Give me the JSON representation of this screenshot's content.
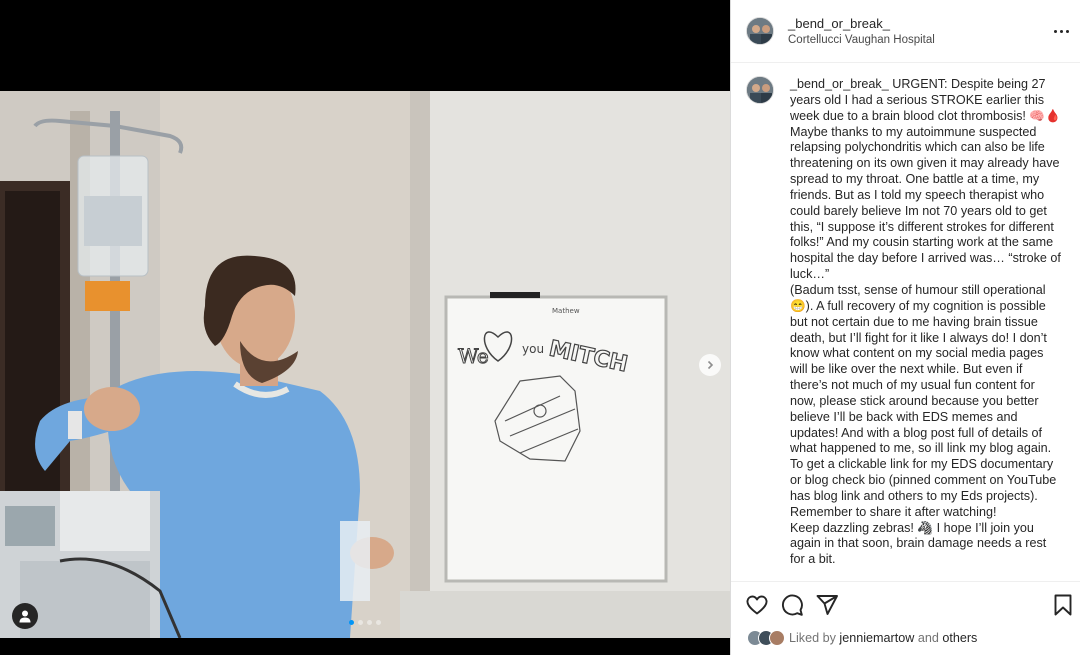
{
  "post": {
    "username": "_bend_or_break_",
    "location": "Cortellucci Vaughan Hospital",
    "avatar_icon": "profile-photo",
    "more_icon": "more-horizontal-icon"
  },
  "caption": {
    "username": "_bend_or_break_",
    "text": "URGENT: Despite being 27 years old I had a serious STROKE earlier this week due to a brain blood clot thrombosis! 🧠🩸\nMaybe thanks to my autoimmune suspected relapsing polychondritis which can also be life threatening on its own given it may already have spread to my throat. One battle at a time, my friends. But as I told my speech therapist who could barely believe Im not 70 years old to get this, “I suppose it’s different strokes for different folks!” And my cousin starting work at the same hospital the day before I arrived was… “stroke of luck…”\n(Badum tsst, sense of humour still operational 😁). A full recovery of my cognition is possible but not certain due to me having brain tissue death, but I’ll fight for it like I always do! I don’t know what content on my social media pages will be like over the next while. But even if there’s not much of my usual fun content for now, please stick around because you better believe I’ll be back with EDS memes and updates! And with a blog post full of details of what happened to me, so ill link my blog again. To get a clickable link for my EDS documentary or blog check bio (pinned comment on YouTube has blog link and others to my Eds projects). Remember to share it after watching!\nKeep dazzling zebras! 🦓 I hope I’ll join you again in that soon, brain damage needs a rest for a bit."
  },
  "photo": {
    "whiteboard_small": "Mathew",
    "whiteboard_we": "We",
    "whiteboard_you": "you",
    "whiteboard_name": "MITCH",
    "carousel_count": 4,
    "carousel_active": 0
  },
  "actions": {
    "like_icon": "heart-icon",
    "comment_icon": "comment-icon",
    "share_icon": "send-icon",
    "save_icon": "bookmark-icon"
  },
  "likes": {
    "prefix": "Liked by",
    "user": "jenniemartow",
    "and": "and",
    "others": "others"
  },
  "colors": {
    "accent": "#0095f6",
    "text": "#262626",
    "muted": "#737373",
    "border": "#dbdbdb"
  }
}
